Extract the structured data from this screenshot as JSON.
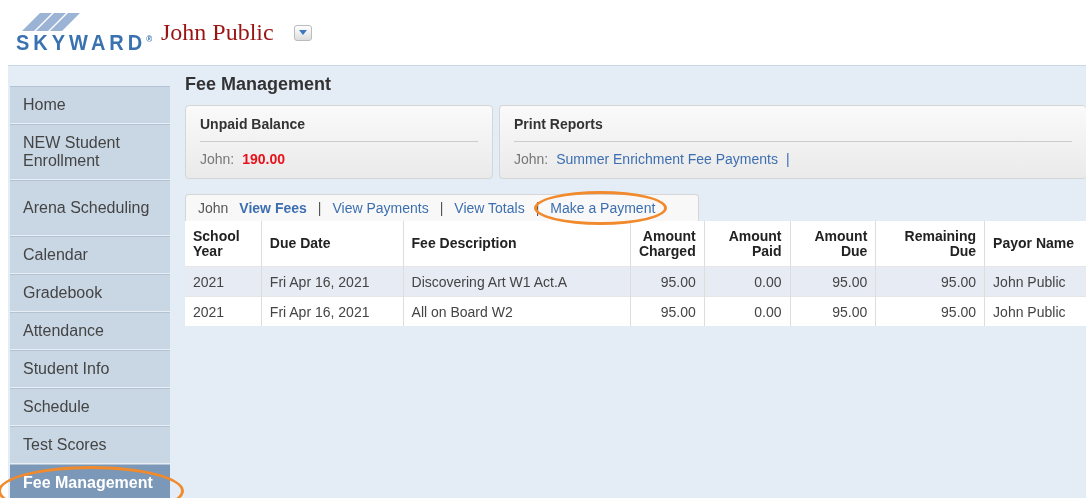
{
  "header": {
    "logo": "SKYWARD",
    "logo_mark": "®",
    "user_name": "John Public"
  },
  "sidebar": {
    "items": [
      {
        "label": "Home",
        "selected": false,
        "highlighted": false
      },
      {
        "label": "NEW Student Enrollment",
        "selected": false,
        "highlighted": false
      },
      {
        "label": "Arena Scheduling",
        "selected": false,
        "highlighted": false
      },
      {
        "label": "Calendar",
        "selected": false,
        "highlighted": false
      },
      {
        "label": "Gradebook",
        "selected": false,
        "highlighted": false
      },
      {
        "label": "Attendance",
        "selected": false,
        "highlighted": false
      },
      {
        "label": "Student Info",
        "selected": false,
        "highlighted": false
      },
      {
        "label": "Schedule",
        "selected": false,
        "highlighted": false
      },
      {
        "label": "Test Scores",
        "selected": false,
        "highlighted": false
      },
      {
        "label": "Fee Management",
        "selected": true,
        "highlighted": true
      }
    ]
  },
  "page_title": "Fee Management",
  "unpaid_balance": {
    "title": "Unpaid Balance",
    "student": "John:",
    "amount": "190.00"
  },
  "print_reports": {
    "title": "Print Reports",
    "student": "John:",
    "link": "Summer Enrichment Fee Payments",
    "separator": "|"
  },
  "tabs": {
    "student": "John",
    "items": [
      {
        "label": "View Fees",
        "selected": true,
        "highlighted": false
      },
      {
        "label": "View Payments",
        "selected": false,
        "highlighted": false
      },
      {
        "label": "View Totals",
        "selected": false,
        "highlighted": false
      },
      {
        "label": "Make a Payment",
        "selected": false,
        "highlighted": true
      }
    ],
    "separator": "|"
  },
  "table": {
    "columns": [
      {
        "label": "School Year"
      },
      {
        "label": "Due Date"
      },
      {
        "label": "Fee Description"
      },
      {
        "label": "Amount Charged"
      },
      {
        "label": "Amount Paid"
      },
      {
        "label": "Amount Due"
      },
      {
        "label": "Remaining Due"
      },
      {
        "label": "Payor Name"
      }
    ],
    "rows": [
      {
        "selected": true,
        "cells": [
          "2021",
          "Fri Apr 16, 2021",
          "Discovering Art W1 Act.A",
          "95.00",
          "0.00",
          "95.00",
          "95.00",
          "John Public"
        ]
      },
      {
        "selected": false,
        "cells": [
          "2021",
          "Fri Apr 16, 2021",
          "All on Board W2",
          "95.00",
          "0.00",
          "95.00",
          "95.00",
          "John Public"
        ]
      }
    ]
  }
}
